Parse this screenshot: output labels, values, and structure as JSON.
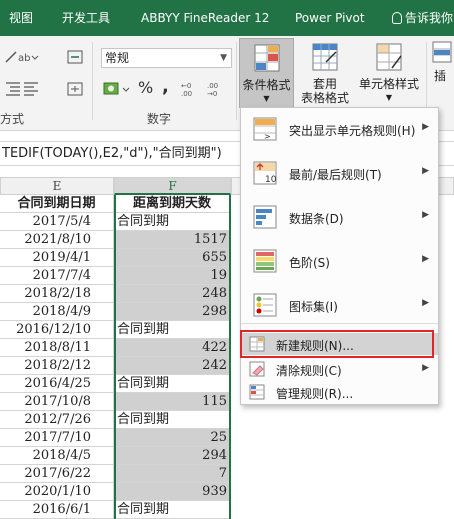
{
  "tabs": [
    {
      "label": "视图"
    },
    {
      "label": "开发工具"
    },
    {
      "label": "ABBYY FineReader 12"
    },
    {
      "label": "Power Pivot"
    }
  ],
  "tell_me": "告诉我你",
  "ribbon": {
    "alignment_group_label": "方式",
    "number_group_label": "数字",
    "number_format_value": "常规",
    "percent_symbol": "%",
    "comma_symbol": ",",
    "conditional_format_label": "条件格式",
    "format_as_table_label_1": "套用",
    "format_as_table_label_2": "表格格式",
    "cell_styles_label": "单元格样式",
    "insert_label": "插"
  },
  "formula_bar": "TEDIF(TODAY(),E2,\"d\"),\"合同到期\")",
  "columns": {
    "e": "E",
    "f": "F"
  },
  "table": {
    "header_e": "合同到期日期",
    "header_f": "距离到期天数",
    "rows": [
      {
        "e": "2017/5/4",
        "f": "合同到期"
      },
      {
        "e": "2021/8/10",
        "f": "1517"
      },
      {
        "e": "2019/4/1",
        "f": "655"
      },
      {
        "e": "2017/7/4",
        "f": "19"
      },
      {
        "e": "2018/2/18",
        "f": "248"
      },
      {
        "e": "2018/4/9",
        "f": "298"
      },
      {
        "e": "2016/12/10",
        "f": "合同到期"
      },
      {
        "e": "2018/8/11",
        "f": "422"
      },
      {
        "e": "2018/2/12",
        "f": "242"
      },
      {
        "e": "2016/4/25",
        "f": "合同到期"
      },
      {
        "e": "2017/10/8",
        "f": "115"
      },
      {
        "e": "2012/7/26",
        "f": "合同到期"
      },
      {
        "e": "2017/7/10",
        "f": "25"
      },
      {
        "e": "2018/4/5",
        "f": "294"
      },
      {
        "e": "2017/6/22",
        "f": "7"
      },
      {
        "e": "2020/1/10",
        "f": "939"
      },
      {
        "e": "2016/6/1",
        "f": "合同到期"
      }
    ]
  },
  "menu": {
    "items": [
      {
        "label": "突出显示单元格规则(H)",
        "icon": "highlight-rules-icon"
      },
      {
        "label": "最前/最后规则(T)",
        "icon": "top-bottom-rules-icon"
      },
      {
        "label": "数据条(D)",
        "icon": "data-bars-icon"
      },
      {
        "label": "色阶(S)",
        "icon": "color-scales-icon"
      },
      {
        "label": "图标集(I)",
        "icon": "icon-sets-icon"
      }
    ],
    "new_rule": "新建规则(N)...",
    "clear_rules": "清除规则(C)",
    "manage_rules": "管理规则(R)...",
    "top_bottom_icon_text": "10"
  },
  "colors": {
    "ribbon_green": "#217346",
    "highlight_red": "#e0262a",
    "gray_fill": "#d0d0d0"
  }
}
